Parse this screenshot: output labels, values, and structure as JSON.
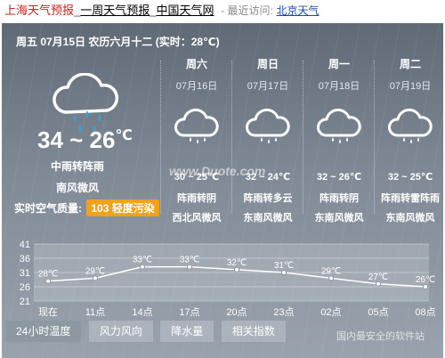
{
  "header": {
    "title_city_weather": "上海天气预报",
    "separator": "_",
    "title_week_weather": "一周天气预报",
    "separator2": "_",
    "title_site": "中国天气网",
    "recent_label": "- 最近访问:",
    "recent_city": "北京天气"
  },
  "today": {
    "date_line": "周五 07月15日 农历六月十二 (实时：28℃)",
    "temp_range": "34 ~ 26",
    "temp_unit": "℃",
    "weather": "中雨转阵雨",
    "wind": "南风微风",
    "aqi_label": "实时空气质量:",
    "aqi_badge": "103 轻度污染",
    "icon": "rain-cloud-icon"
  },
  "forecast": [
    {
      "day": "周六",
      "date": "07月16日",
      "temp": "30 ~ 25℃",
      "weather": "阵雨转阴",
      "wind": "西北风微风",
      "icon": "rain-cloud-icon"
    },
    {
      "day": "周日",
      "date": "07月17日",
      "temp": "32 ~ 24℃",
      "weather": "阵雨转多云",
      "wind": "东南风微风",
      "icon": "rain-cloud-icon"
    },
    {
      "day": "周一",
      "date": "07月18日",
      "temp": "32 ~ 26℃",
      "weather": "阵雨转阴",
      "wind": "东南风微风",
      "icon": "rain-cloud-icon"
    },
    {
      "day": "周二",
      "date": "07月19日",
      "temp": "32 ~ 25℃",
      "weather": "阵雨转雷阵雨",
      "wind": "东南风微风",
      "icon": "rain-cloud-icon"
    }
  ],
  "chart_data": {
    "type": "line",
    "title": "",
    "xlabel": "",
    "ylabel": "",
    "categories": [
      "现在",
      "11点",
      "14点",
      "17点",
      "20点",
      "23点",
      "02点",
      "05点",
      "08点"
    ],
    "yticks": [
      41,
      36,
      31,
      26,
      21
    ],
    "ylim": [
      21,
      41
    ],
    "series": [
      {
        "values": [
          28,
          29,
          33,
          33,
          32,
          31,
          29,
          27,
          26
        ],
        "labels": [
          "28℃",
          "29℃",
          "33℃",
          "33℃",
          "32℃",
          "31℃",
          "29℃",
          "27℃",
          "26℃"
        ]
      }
    ],
    "grid": true
  },
  "tabs": [
    "24小时温度",
    "风力风向",
    "降水量",
    "相关指数"
  ],
  "watermarks": {
    "duote": "www.Duote.com",
    "bottom": "国内最安全的软件站"
  },
  "colors": {
    "aqi_badge": "#f1a11a",
    "header_red": "#c8231e",
    "link_blue": "#1a48b0"
  }
}
